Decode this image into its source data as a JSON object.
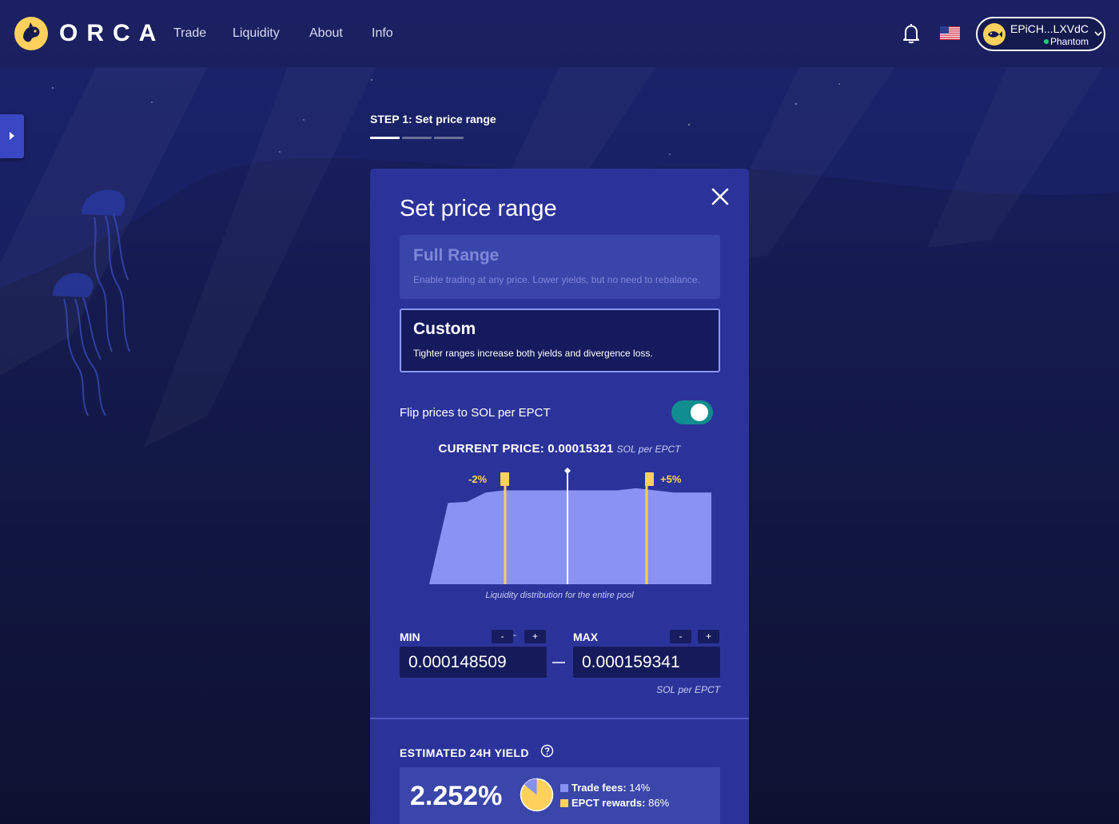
{
  "brand": {
    "name": "ORCA",
    "logo_icon": "orca-whale-logo"
  },
  "nav": [
    {
      "label": "Trade"
    },
    {
      "label": "Liquidity"
    },
    {
      "label": "About"
    },
    {
      "label": "Info"
    }
  ],
  "header": {
    "notification_icon": "bell-icon",
    "region_icon": "us-flag-icon",
    "wallet": {
      "address": "EPiCH...LXVdC",
      "provider": "Phantom",
      "status_color": "#21d07a"
    }
  },
  "step": {
    "label": "STEP 1: Set price range",
    "total_steps": 3,
    "current_step": 1
  },
  "modal": {
    "title": "Set price range",
    "options": {
      "full": {
        "title": "Full Range",
        "description": "Enable trading at any price. Lower yields, but no need to rebalance."
      },
      "custom": {
        "title": "Custom",
        "description": "Tighter ranges increase both yields and divergence loss.",
        "selected": true
      }
    },
    "flip": {
      "label": "Flip prices to SOL per EPCT",
      "enabled": true
    },
    "current_price": {
      "label": "CURRENT PRICE:",
      "value": "0.00015321",
      "unit": "SOL per EPCT"
    },
    "chart_caption": "Liquidity distribution for the entire pool",
    "range": {
      "min_label": "MIN",
      "max_label": "MAX",
      "decrement": "-",
      "increment": "+",
      "min_value": "0.000148509",
      "max_value": "0.000159341",
      "unit": "SOL per EPCT"
    },
    "yield": {
      "label": "ESTIMATED 24H YIELD",
      "value": "2.252%",
      "trade_fees_label": "Trade fees:",
      "trade_fees_value": "14%",
      "rewards_label": "EPCT rewards:",
      "rewards_value": "86%",
      "trade_fees_color": "#8690f0",
      "rewards_color": "#ffd15c"
    }
  },
  "chart_data": {
    "type": "area",
    "title": "",
    "xlabel": "",
    "ylabel": "",
    "relative_liquidity": [
      0,
      0.78,
      0.79,
      0.88,
      0.9,
      0.9,
      0.9,
      0.9,
      0.9,
      0.9,
      0.9,
      0.92,
      0.9,
      0.88,
      0.88,
      0.88
    ],
    "lower_handle_label": "-2%",
    "upper_handle_label": "+5%",
    "lower_handle_pct": -2,
    "upper_handle_pct": 5,
    "current_price_marker": "0.00015321",
    "colors": {
      "area": "#8a93f3",
      "handles": "#ffd15c",
      "current": "#ffffff"
    }
  }
}
